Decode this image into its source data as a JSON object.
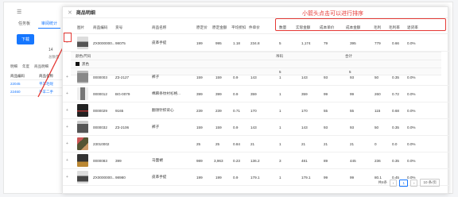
{
  "background": {
    "menu_glyph": "☰",
    "tabs": [
      "任务板",
      "审阅统计"
    ],
    "button": "下载",
    "count": "14",
    "subtext": "总数量",
    "filter": [
      "明细",
      "年度",
      "商品明细"
    ],
    "grid": [
      [
        "商品编码",
        "商品名称"
      ],
      [
        "22045",
        "平羊毛呢"
      ],
      [
        "22460",
        "平羊二手"
      ]
    ]
  },
  "modal": {
    "title": "商品明细",
    "headers": {
      "image": "图片",
      "code": "商品编码",
      "goods_no": "货号",
      "name": "商品名称",
      "sales_price": "原定价",
      "sales_amount": "原定金额",
      "avg_discount": "平均折扣",
      "unit_price": "件单价",
      "qty": "数量",
      "actual_amount": "实际金额",
      "cost_price": "成本单价",
      "cost_amount": "成本金额",
      "gross": "毛利",
      "gross_rate": "毛利率",
      "return_rate": "退货率"
    },
    "annotation": "小箭头点击可以进行排序",
    "expanded": {
      "headers": [
        "颜色/尺码",
        "吊码",
        "合计"
      ],
      "row_label": "黑色",
      "values": [
        "5",
        "5"
      ]
    },
    "rows": [
      {
        "code": "ZX0000000...",
        "goods_no": "98075",
        "name": "皮革手提",
        "price": "199",
        "amount": "995",
        "discount": "1.18",
        "unit": "234.8",
        "qty": "5",
        "actual": "1,174",
        "cost": "79",
        "cost_amount": "395",
        "gross": "779",
        "rate": "0.66",
        "ret": "0.0%"
      },
      {
        "code": "0000003",
        "goods_no": "Z3-2127",
        "name": "裤子",
        "price": "159",
        "amount": "159",
        "discount": "0.9",
        "unit": "143",
        "qty": "1",
        "actual": "143",
        "cost": "93",
        "cost_amount": "93",
        "gross": "50",
        "rate": "0.35",
        "ret": "0.0%"
      },
      {
        "code": "0000012",
        "goods_no": "BG-0079",
        "name": "棉麻条纹衬衫格...",
        "price": "399",
        "amount": "399",
        "discount": "0.9",
        "unit": "359",
        "qty": "1",
        "actual": "359",
        "cost": "99",
        "cost_amount": "99",
        "gross": "260",
        "rate": "0.72",
        "ret": "0.0%"
      },
      {
        "code": "0000029",
        "goods_no": "9165",
        "name": "翻领针织背心",
        "price": "239",
        "amount": "239",
        "discount": "0.71",
        "unit": "170",
        "qty": "1",
        "actual": "170",
        "cost": "55",
        "cost_amount": "55",
        "gross": "115",
        "rate": "0.68",
        "ret": "0.0%"
      },
      {
        "code": "0000032",
        "goods_no": "Z3-2106",
        "name": "裤子",
        "price": "159",
        "amount": "159",
        "discount": "0.9",
        "unit": "143",
        "qty": "1",
        "actual": "143",
        "cost": "93",
        "cost_amount": "93",
        "gross": "50",
        "rate": "0.35",
        "ret": "0.0%"
      },
      {
        "code": "23010002",
        "goods_no": "",
        "name": "",
        "price": "25",
        "amount": "25",
        "discount": "0.84",
        "unit": "21",
        "qty": "1",
        "actual": "21",
        "cost": "21",
        "cost_amount": "21",
        "gross": "0",
        "rate": "0.0",
        "ret": "0.0%"
      },
      {
        "code": "0000083",
        "goods_no": "399",
        "name": "马面裙",
        "price": "989",
        "amount": "3,963",
        "discount": "0.23",
        "unit": "136.2",
        "qty": "3",
        "actual": "481",
        "cost": "89",
        "cost_amount": "445",
        "gross": "236",
        "rate": "0.35",
        "ret": "0.0%"
      },
      {
        "code": "ZX0000000...",
        "goods_no": "98980",
        "name": "皮革手提",
        "price": "199",
        "amount": "199",
        "discount": "0.9",
        "unit": "179.1",
        "qty": "1",
        "actual": "179.1",
        "cost": "99",
        "cost_amount": "99",
        "gross": "80.1",
        "rate": "0.45",
        "ret": "0.0%"
      }
    ],
    "pager": {
      "total": "共8条",
      "page": "1",
      "size": "10 条/页"
    }
  }
}
